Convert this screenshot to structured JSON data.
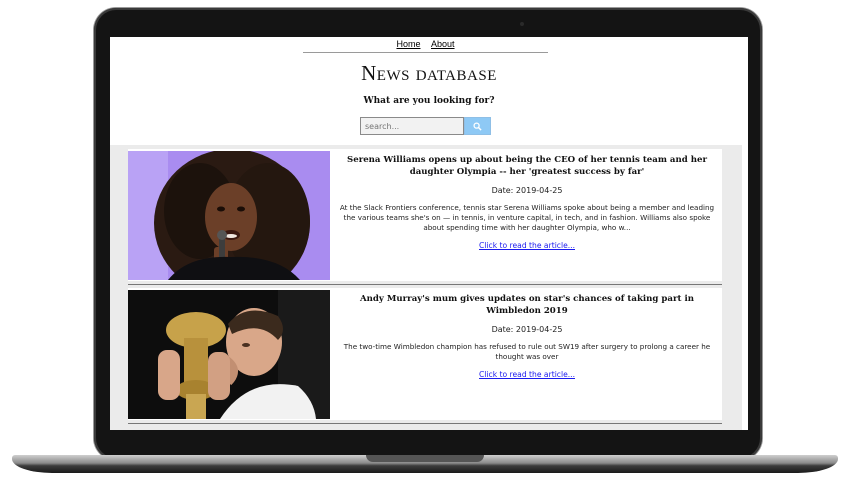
{
  "nav": {
    "home": "Home",
    "about": "About"
  },
  "site_title": "News database",
  "prompt": "What are you looking for?",
  "search": {
    "placeholder": "search...",
    "icon": "search-icon"
  },
  "articles": [
    {
      "title": "Serena Williams opens up about being the CEO of her tennis team and her daughter Olympia -- her 'greatest success by far'",
      "date": "Date: 2019-04-25",
      "summary": "At the Slack Frontiers conference, tennis star Serena Williams spoke about being a member and leading the various teams she's on — in tennis, in venture capital, in tech, and in fashion. Williams also spoke about spending time with her daughter Olympia, who w...",
      "link": "Click to read the article..."
    },
    {
      "title": "Andy Murray's mum gives updates on star's chances of taking part in Wimbledon 2019",
      "date": "Date: 2019-04-25",
      "summary": "The two-time Wimbledon champion has refused to rule out SW19 after surgery to prolong a career he thought was over",
      "link": "Click to read the article..."
    }
  ],
  "colors": {
    "search_button": "#8ec9f5",
    "link": "#1a1aee",
    "list_bg": "#ebebeb"
  }
}
